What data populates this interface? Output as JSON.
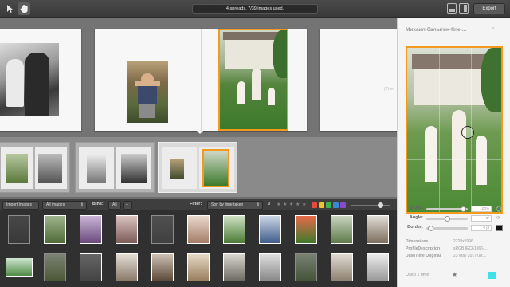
{
  "toolbar": {
    "status": "4 spreads. 7/39 images used.",
    "export_label": "Export",
    "tools": [
      "pointer-tool",
      "hand-tool"
    ]
  },
  "canvas": {
    "resize_hint": "(Thre"
  },
  "strip": {
    "spreads": [
      "spread-1",
      "spread-2",
      "spread-3",
      "spread-4"
    ],
    "active_index": 3
  },
  "filterbar": {
    "import_label": "Import Images",
    "album_select": "All images",
    "bins_label": "Bins:",
    "bins_select": "All",
    "add_bin": "+",
    "filter_label": "Filter:",
    "sort_select": "Sort by time taken",
    "sort_order": "≥",
    "stars": [
      "★",
      "★",
      "★",
      "★",
      "★"
    ],
    "colors": [
      "#e84a3b",
      "#f0c030",
      "#3fb34f",
      "#3b86d8",
      "#8e4bc8"
    ],
    "zoom_level": 0.8
  },
  "inspector": {
    "title": "Михаил-балыгин-fine-...",
    "close_icon": "×",
    "scale_label": "Scale:",
    "scale_value": "100%",
    "scale_level": 0.95,
    "angle_label": "Angle:",
    "angle_value": "0°",
    "angle_level": 0.5,
    "border_label": "Border:",
    "border_value": "0 pt",
    "border_level": 0.05,
    "meta": [
      {
        "key": "Dimensions",
        "value": "2228x2996"
      },
      {
        "key": "ProfileDescription",
        "value": "sRGB IEC61966-..."
      },
      {
        "key": "Date/Time Original",
        "value": "23 May 2017 08:..."
      }
    ],
    "usage": "Used 1 time",
    "accent_color": "#f29a1e"
  }
}
